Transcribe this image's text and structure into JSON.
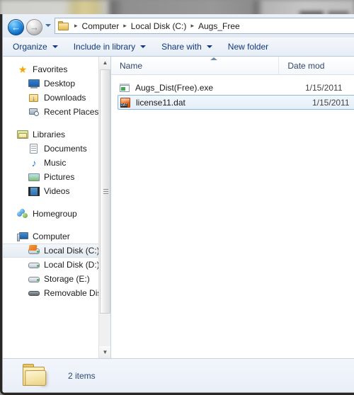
{
  "window": {
    "addressbar": {
      "back_icon": "back-arrow-icon",
      "back_glyph": "←",
      "forward_icon": "forward-arrow-icon",
      "forward_glyph": "→",
      "dropdown_icon": "chevron-down-icon",
      "folder_icon": "folder-icon",
      "separator": "▸",
      "crumbs": [
        {
          "label": "Computer"
        },
        {
          "label": "Local Disk (C:)"
        },
        {
          "label": "Augs_Free"
        }
      ]
    },
    "toolbar": {
      "items": [
        {
          "label": "Organize",
          "has_caret": true
        },
        {
          "label": "Include in library",
          "has_caret": true
        },
        {
          "label": "Share with",
          "has_caret": true
        },
        {
          "label": "New folder",
          "has_caret": false
        }
      ]
    },
    "sidebar": {
      "scrollbar": {
        "up_glyph": "▲",
        "down_glyph": "▼"
      },
      "groups": [
        {
          "header": {
            "label": "Favorites",
            "icon": "star-icon"
          },
          "items": [
            {
              "label": "Desktop",
              "icon": "desktop-icon",
              "selected": false
            },
            {
              "label": "Downloads",
              "icon": "downloads-folder-icon",
              "selected": false
            },
            {
              "label": "Recent Places",
              "icon": "recent-places-icon",
              "selected": false
            }
          ]
        },
        {
          "header": {
            "label": "Libraries",
            "icon": "library-folder-icon"
          },
          "items": [
            {
              "label": "Documents",
              "icon": "document-icon",
              "selected": false
            },
            {
              "label": "Music",
              "icon": "music-note-icon",
              "selected": false
            },
            {
              "label": "Pictures",
              "icon": "picture-icon",
              "selected": false
            },
            {
              "label": "Videos",
              "icon": "video-filmstrip-icon",
              "selected": false
            }
          ]
        },
        {
          "header": {
            "label": "Homegroup",
            "icon": "homegroup-icon"
          },
          "items": []
        },
        {
          "header": {
            "label": "Computer",
            "icon": "computer-icon"
          },
          "items": [
            {
              "label": "Local Disk (C:)",
              "icon": "system-drive-icon",
              "selected": true
            },
            {
              "label": "Local Disk (D:)",
              "icon": "hard-drive-icon",
              "selected": false
            },
            {
              "label": "Storage (E:)",
              "icon": "hard-drive-icon",
              "selected": false
            },
            {
              "label": "Removable Disk (",
              "icon": "removable-disk-icon",
              "selected": false
            }
          ]
        }
      ]
    },
    "filepane": {
      "columns": [
        {
          "label": "Name",
          "sorted": true,
          "sort_icon": "sort-ascending-icon"
        },
        {
          "label": "Date mod",
          "sorted": false
        }
      ],
      "rows": [
        {
          "name": "Augs_Dist(Free).exe",
          "date": "1/15/2011",
          "icon": "exe-application-icon",
          "icon_type": "exe",
          "icon_text": "",
          "selected": false
        },
        {
          "name": "license11.dat",
          "date": "1/15/2011",
          "icon": "dat-file-icon",
          "icon_type": "dat",
          "icon_text": "DAT",
          "selected": true
        }
      ]
    },
    "statusbar": {
      "folder_icon": "folder-icon",
      "item_count_text": "2 items"
    }
  },
  "colors": {
    "accent": "#10387a",
    "selection_border": "#8cb8e0",
    "selection_fill": "#e4eff9",
    "chrome": "#dfe9f5",
    "frame": "#2b2622"
  }
}
